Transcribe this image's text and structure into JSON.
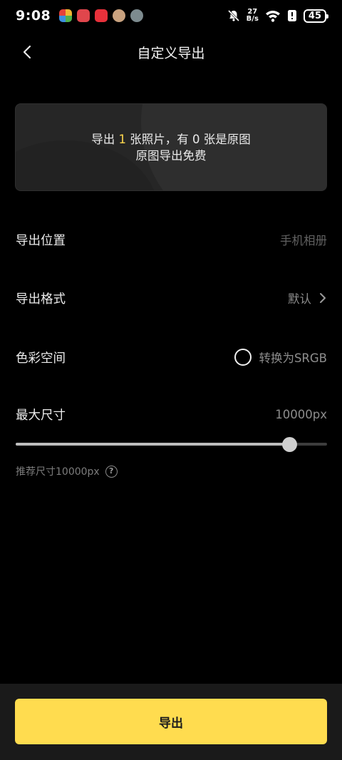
{
  "status_bar": {
    "time": "9:08",
    "net_speed_value": "27",
    "net_speed_unit": "B/s",
    "battery": "45",
    "notification_colors": [
      "#e5413a",
      "#e0464c",
      "#e8313b",
      "#c9a27f",
      "#7d8b8f"
    ]
  },
  "header": {
    "title": "自定义导出"
  },
  "info_card": {
    "line1_prefix": "导出 ",
    "photo_count": "1",
    "line1_suffix": " 张照片，有 0 张是原图",
    "line2": "原图导出免费"
  },
  "settings": {
    "location_label": "导出位置",
    "location_value": "手机相册",
    "format_label": "导出格式",
    "format_value": "默认",
    "colorspace_label": "色彩空间",
    "colorspace_option": "转换为SRGB",
    "max_size_label": "最大尺寸",
    "max_size_value": "10000px",
    "slider_fraction": 0.88,
    "hint": "推荐尺寸10000px",
    "help_glyph": "?"
  },
  "export_button_label": "导出",
  "colors": {
    "accent": "#ffdc4f",
    "highlight": "#ffd84d",
    "background": "#000000"
  }
}
